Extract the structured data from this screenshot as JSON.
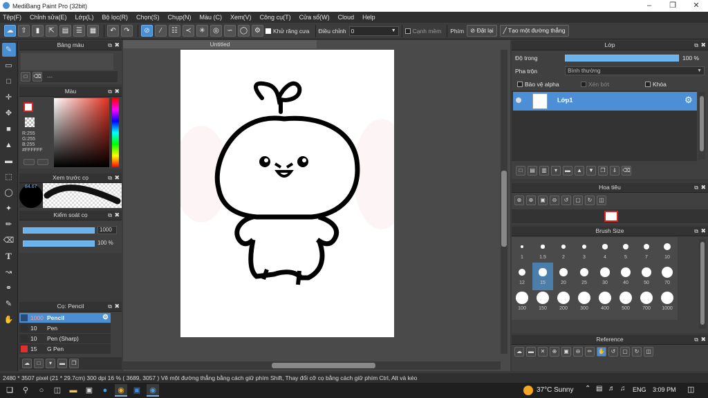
{
  "window": {
    "title": "MediBang Paint Pro (32bit)"
  },
  "menu": [
    "Tệp(F)",
    "Chỉnh sửa(E)",
    "Lớp(L)",
    "Bộ lọc(R)",
    "Chọn(S)",
    "Chụp(N)",
    "Màu (C)",
    "Xem(V)",
    "Công cụ(T)",
    "Cửa sổ(W)",
    "Cloud",
    "Help"
  ],
  "toolbar": {
    "antialias": "Khử răng cưa",
    "correction": "Điều chỉnh",
    "correction_value": "0",
    "soft_edge": "Cạnh mềm",
    "shortcut": "Phím",
    "reset": "Đặt lại",
    "straight_line": "Tạo một đường thẳng"
  },
  "panels": {
    "palette": {
      "title": "Bảng màu",
      "field": "---"
    },
    "color": {
      "title": "Màu",
      "r": "R:255",
      "g": "G:255",
      "b": "B:255",
      "hex": "#FFFFFF"
    },
    "brush_preview": {
      "title": "Xem trước cọ",
      "size": "84.67"
    },
    "brush_control": {
      "title": "Kiểm soát cọ",
      "size": "1000",
      "opacity": "100 %"
    },
    "brush_list": {
      "title": "Cọ: Pencil",
      "items": [
        {
          "size": "1000",
          "name": "Pencil",
          "color": "#2a4a78",
          "selected": true
        },
        {
          "size": "10",
          "name": "Pen",
          "color": "#2f2f2f",
          "selected": false
        },
        {
          "size": "10",
          "name": "Pen (Sharp)",
          "color": "#2f2f2f",
          "selected": false
        },
        {
          "size": "15",
          "name": "G Pen",
          "color": "#e0302d",
          "selected": false
        }
      ]
    },
    "layer": {
      "title": "Lớp",
      "opacity_label": "Độ trong",
      "opacity_value": "100 %",
      "blend_label": "Pha trộn",
      "blend_value": "Bình thường",
      "protect_alpha": "Bảo vệ alpha",
      "clipping": "Xén bớt",
      "lock": "Khóa",
      "layer_name": "Lớp1"
    },
    "navigator": {
      "title": "Hoa tiêu"
    },
    "brush_size": {
      "title": "Brush Size",
      "sizes": [
        "1",
        "1.5",
        "2",
        "3",
        "4",
        "5",
        "7",
        "10",
        "12",
        "15",
        "20",
        "25",
        "30",
        "40",
        "50",
        "70",
        "100",
        "150",
        "200",
        "300",
        "400",
        "500",
        "700",
        "1000"
      ],
      "selected": "15"
    },
    "reference": {
      "title": "Reference"
    }
  },
  "document": {
    "tab": "Untitled"
  },
  "status": "2480 * 3507 pixel  (21 * 29.7cm)  300 dpi  16 %  ( 3689, 3057 )  Vẽ một đường thẳng bằng cách giữ phím Shift, Thay đổi cỡ cọ bằng cách giữ phím Ctrl, Alt và kéo",
  "taskbar": {
    "weather": "37°C  Sunny",
    "lang": "ENG",
    "time": "3:09 PM"
  },
  "colors": {
    "accent": "#4a8fd3",
    "layer_selected": "#4d8fd6",
    "slider": "#6ab3ec"
  }
}
